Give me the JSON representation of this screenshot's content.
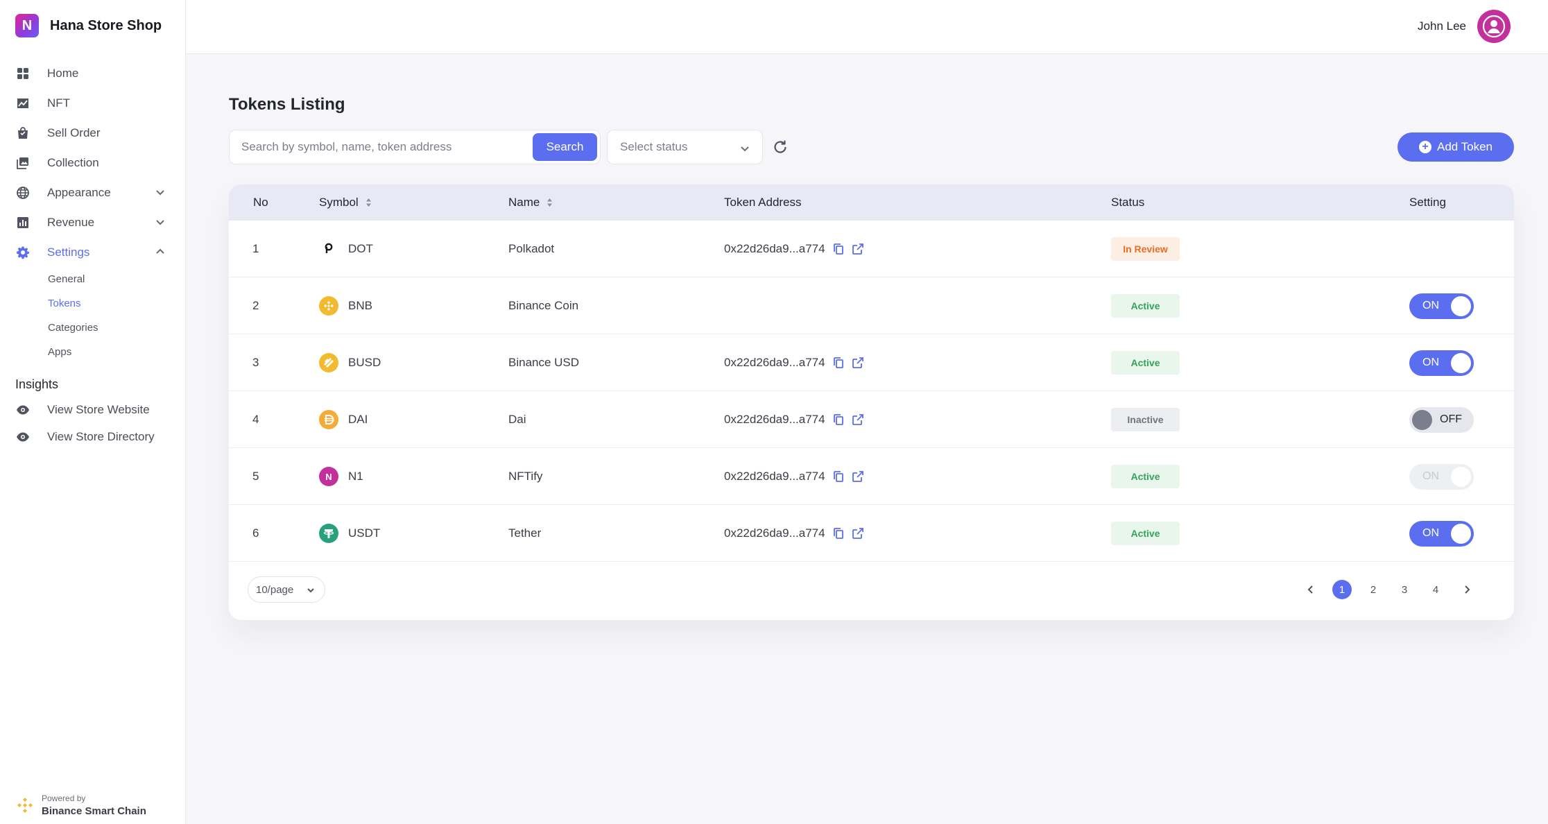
{
  "brand": {
    "name": "Hana Store Shop",
    "logo_letter": "N"
  },
  "user": {
    "name": "John Lee"
  },
  "sidebar": {
    "items": [
      {
        "label": "Home",
        "icon": "grid-icon"
      },
      {
        "label": "NFT",
        "icon": "chart-line-icon"
      },
      {
        "label": "Sell Order",
        "icon": "shopping-bag-icon"
      },
      {
        "label": "Collection",
        "icon": "gallery-icon"
      },
      {
        "label": "Appearance",
        "icon": "globe-icon"
      },
      {
        "label": "Revenue",
        "icon": "bar-chart-icon"
      },
      {
        "label": "Settings",
        "icon": "gear-icon"
      }
    ],
    "settings_sub": [
      "General",
      "Tokens",
      "Categories",
      "Apps"
    ],
    "insights_title": "Insights",
    "insights": [
      "View Store Website",
      "View Store Directory"
    ],
    "powered_small": "Powered by",
    "powered_big": "Binance Smart Chain"
  },
  "main": {
    "title": "Tokens Listing",
    "search_placeholder": "Search by symbol, name, token address",
    "search_button": "Search",
    "status_placeholder": "Select status",
    "add_button": "Add Token"
  },
  "table": {
    "headers": {
      "no": "No",
      "symbol": "Symbol",
      "name": "Name",
      "address": "Token Address",
      "status": "Status",
      "setting": "Setting"
    },
    "rows": [
      {
        "no": "1",
        "symbol": "DOT",
        "name": "Polkadot",
        "address": "0x22d26da9...a774",
        "status": "In Review",
        "setting": ""
      },
      {
        "no": "2",
        "symbol": "BNB",
        "name": "Binance Coin",
        "address": "",
        "status": "Active",
        "setting": "ON"
      },
      {
        "no": "3",
        "symbol": "BUSD",
        "name": "Binance USD",
        "address": "0x22d26da9...a774",
        "status": "Active",
        "setting": "ON"
      },
      {
        "no": "4",
        "symbol": "DAI",
        "name": "Dai",
        "address": "0x22d26da9...a774",
        "status": "Inactive",
        "setting": "OFF"
      },
      {
        "no": "5",
        "symbol": "N1",
        "name": "NFTify",
        "address": "0x22d26da9...a774",
        "status": "Active",
        "setting": "ON"
      },
      {
        "no": "6",
        "symbol": "USDT",
        "name": "Tether",
        "address": "0x22d26da9...a774",
        "status": "Active",
        "setting": "ON"
      }
    ]
  },
  "pagination": {
    "page_size": "10/page",
    "pages": [
      "1",
      "2",
      "3",
      "4"
    ],
    "current": "1"
  },
  "colors": {
    "accent": "#5b6ef0",
    "active_text": "#35a35a",
    "review_text": "#e76d24",
    "bnb": "#f3ba2f",
    "usdt": "#26a17b",
    "nftify": "#c2309c"
  }
}
